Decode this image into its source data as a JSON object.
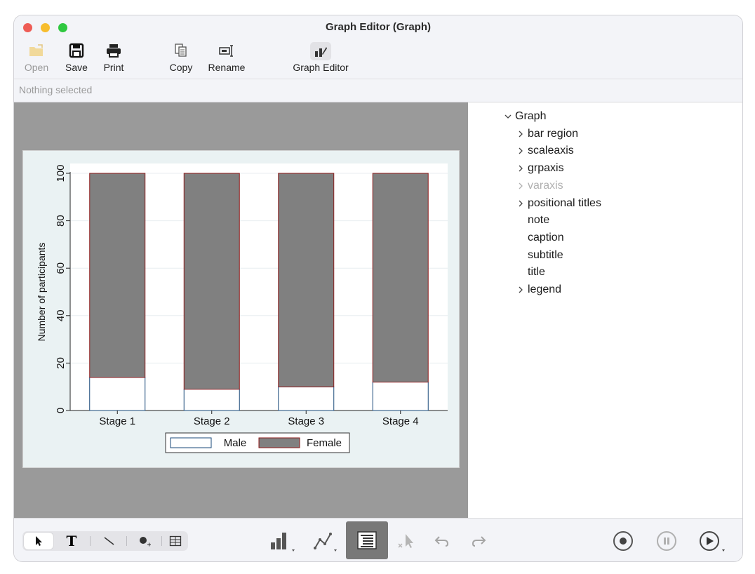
{
  "window": {
    "title": "Graph Editor (Graph)"
  },
  "toolbar": {
    "open_label": "Open",
    "save_label": "Save",
    "print_label": "Print",
    "copy_label": "Copy",
    "rename_label": "Rename",
    "graph_editor_label": "Graph Editor"
  },
  "status": {
    "selection_text": "Nothing selected"
  },
  "tree": {
    "items": [
      {
        "label": "Graph",
        "expander": "expanded",
        "level": 0
      },
      {
        "label": "bar region",
        "expander": "collapsed",
        "level": 1
      },
      {
        "label": "scaleaxis",
        "expander": "collapsed",
        "level": 1
      },
      {
        "label": "grpaxis",
        "expander": "collapsed",
        "level": 1
      },
      {
        "label": "varaxis",
        "expander": "collapsed",
        "level": 1,
        "disabled": true
      },
      {
        "label": "positional titles",
        "expander": "collapsed",
        "level": 1
      },
      {
        "label": "note",
        "expander": "none",
        "level": 1
      },
      {
        "label": "caption",
        "expander": "none",
        "level": 1
      },
      {
        "label": "subtitle",
        "expander": "none",
        "level": 1
      },
      {
        "label": "title",
        "expander": "none",
        "level": 1
      },
      {
        "label": "legend",
        "expander": "collapsed",
        "level": 1
      }
    ]
  },
  "chart_data": {
    "type": "bar",
    "stacked": true,
    "categories": [
      "Stage 1",
      "Stage 2",
      "Stage 3",
      "Stage 4"
    ],
    "series": [
      {
        "name": "Male",
        "values": [
          14,
          9,
          10,
          12
        ],
        "color": "#ffffff",
        "edge": "#1a4a7a"
      },
      {
        "name": "Female",
        "values": [
          86,
          91,
          90,
          88
        ],
        "color": "#808080",
        "edge": "#8b1a1a"
      }
    ],
    "ylabel": "Number of participants",
    "ylim": [
      0,
      100
    ],
    "yticks": [
      0,
      20,
      40,
      60,
      80,
      100
    ],
    "grid": true,
    "legend": "bottom"
  },
  "colors": {
    "accent_selected": "#787878",
    "plot_background": "#eaf2f3",
    "canvas_background": "#9a9a9a"
  },
  "bottom_tools": {
    "left_group": [
      "pointer-tool",
      "text-tool",
      "line-tool",
      "marker-tool",
      "grid-tool"
    ],
    "middle_group": [
      "add-bar-chart",
      "add-line-chart",
      "object-browser",
      "deselect",
      "undo",
      "redo"
    ],
    "right_group": [
      "record",
      "pause",
      "play"
    ]
  }
}
